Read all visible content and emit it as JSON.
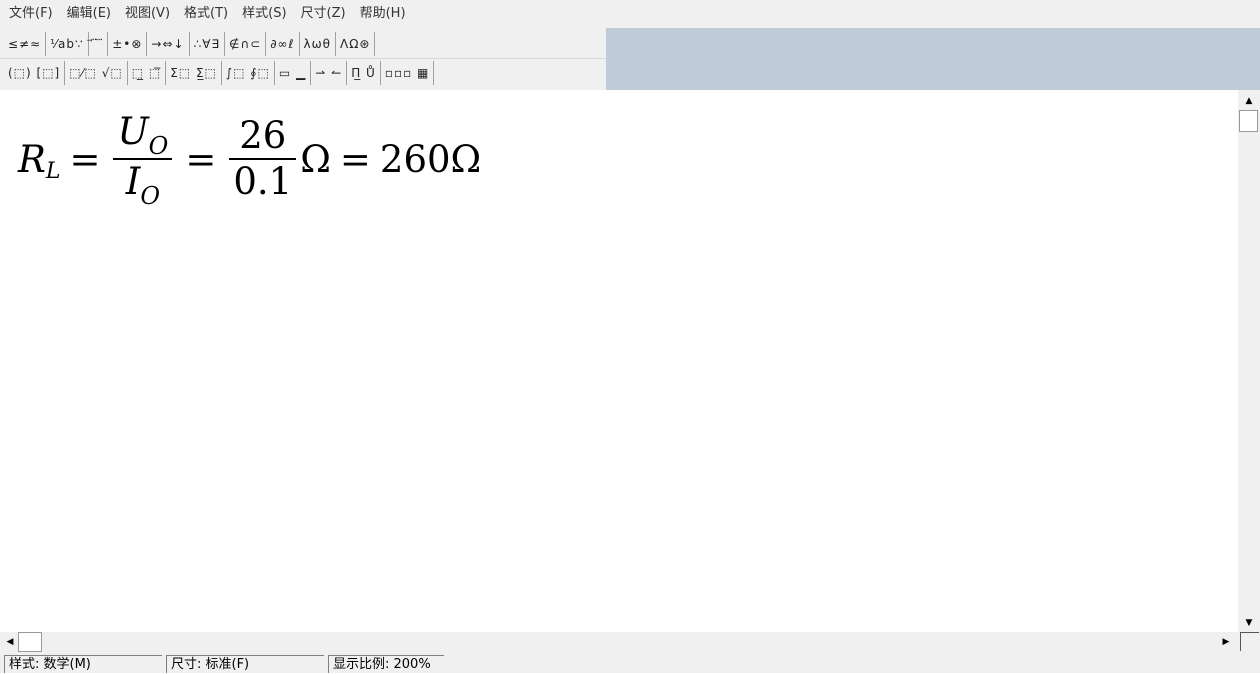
{
  "menu": [
    {
      "label": "文件(F)"
    },
    {
      "label": "编辑(E)"
    },
    {
      "label": "视图(V)"
    },
    {
      "label": "格式(T)"
    },
    {
      "label": "样式(S)"
    },
    {
      "label": "尺寸(Z)"
    },
    {
      "label": "帮助(H)"
    }
  ],
  "toolbar": {
    "row1": [
      {
        "label": "≤≠≈",
        "icon": "relations-palette-icon"
      },
      {
        "label": "⅟ab∵",
        "icon": "spaces-ellipses-palette-icon"
      },
      {
        "label": "⃗ ̈ ⃛",
        "icon": "embellishments-palette-icon"
      },
      {
        "label": "±•⊗",
        "icon": "operators-palette-icon"
      },
      {
        "label": "→⇔↓",
        "icon": "arrows-palette-icon"
      },
      {
        "label": "∴∀∃",
        "icon": "logic-palette-icon"
      },
      {
        "label": "∉∩⊂",
        "icon": "set-theory-palette-icon"
      },
      {
        "label": "∂∞ℓ",
        "icon": "misc-symbols-palette-icon"
      },
      {
        "label": "λωθ",
        "icon": "greek-lowercase-palette-icon"
      },
      {
        "label": "ΛΩ⊛",
        "icon": "greek-uppercase-palette-icon"
      }
    ],
    "row2": [
      {
        "label": "(⬚) [⬚]",
        "icon": "fence-templates-icon"
      },
      {
        "label": "⬚⁄⬚ √⬚",
        "icon": "fraction-radical-templates-icon"
      },
      {
        "label": "⬚̲ ⬚̅",
        "icon": "subscript-superscript-templates-icon"
      },
      {
        "label": "Σ⬚ Σ̲⬚",
        "icon": "summation-templates-icon"
      },
      {
        "label": "∫⬚ ∮⬚",
        "icon": "integral-templates-icon"
      },
      {
        "label": "▭ ▁",
        "icon": "underbar-overbar-templates-icon"
      },
      {
        "label": "⇀ ↼",
        "icon": "labeled-arrow-templates-icon"
      },
      {
        "label": "Π̲ Ů",
        "icon": "products-set-templates-icon"
      },
      {
        "label": "▫▫▫ ▦",
        "icon": "matrix-templates-icon"
      }
    ]
  },
  "equation": {
    "lhs_var": "R",
    "lhs_sub": "L",
    "eq1": "=",
    "frac1_num_var": "U",
    "frac1_num_sub": "O",
    "frac1_den_var": "I",
    "frac1_den_sub": "O",
    "eq2": "=",
    "frac2_num": "26",
    "frac2_den": "0.1",
    "unit1": "Ω",
    "eq3": "=",
    "result": "260",
    "unit2": "Ω"
  },
  "scrollbars": {
    "up_arrow": "▲",
    "down_arrow": "▼",
    "left_arrow": "◀",
    "right_arrow": "▶"
  },
  "status": {
    "style": "样式: 数学(M)",
    "size": "尺寸: 标准(F)",
    "zoom": "显示比例: 200%"
  }
}
